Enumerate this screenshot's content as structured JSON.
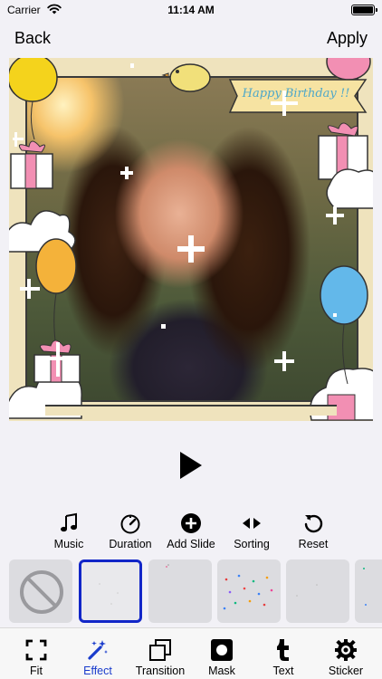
{
  "status_bar": {
    "carrier": "Carrier",
    "time": "11:14 AM"
  },
  "nav": {
    "back_label": "Back",
    "apply_label": "Apply"
  },
  "preview": {
    "banner_text": "Happy Birthday !!"
  },
  "tools": [
    {
      "label": "Music",
      "icon": "music-note-icon"
    },
    {
      "label": "Duration",
      "icon": "timer-icon"
    },
    {
      "label": "Add Slide",
      "icon": "plus-circle-icon"
    },
    {
      "label": "Sorting",
      "icon": "sort-arrows-icon"
    },
    {
      "label": "Reset",
      "icon": "reset-icon"
    }
  ],
  "effects": [
    {
      "id": "none",
      "icon": "no-effect-icon",
      "selected": false
    },
    {
      "id": "effect-1",
      "selected": true
    },
    {
      "id": "effect-2",
      "selected": false
    },
    {
      "id": "effect-3",
      "selected": false
    },
    {
      "id": "effect-4",
      "selected": false
    },
    {
      "id": "effect-5",
      "selected": false
    }
  ],
  "tabs": [
    {
      "label": "Fit",
      "icon": "fit-frame-icon",
      "active": false
    },
    {
      "label": "Effect",
      "icon": "magic-wand-icon",
      "active": true
    },
    {
      "label": "Transition",
      "icon": "transition-icon",
      "active": false
    },
    {
      "label": "Mask",
      "icon": "mask-icon",
      "active": false
    },
    {
      "label": "Text",
      "icon": "text-t-icon",
      "active": false
    },
    {
      "label": "Sticker",
      "icon": "sticker-gear-icon",
      "active": false
    }
  ],
  "colors": {
    "accent": "#1226c8",
    "tab_active": "#1a3ccc",
    "background": "#f2f1f6"
  }
}
